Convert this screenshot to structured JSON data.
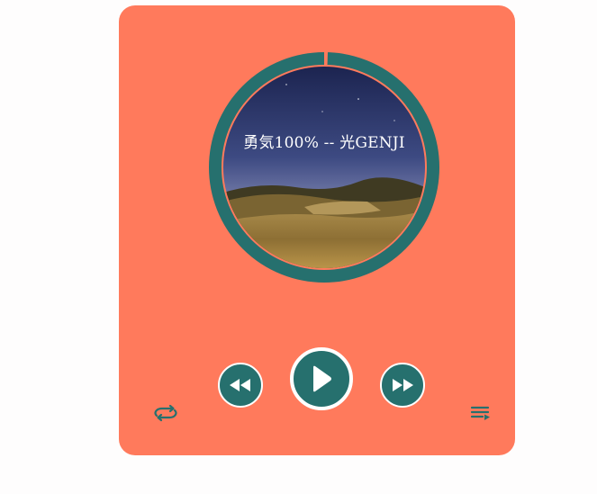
{
  "track": {
    "title": "勇気100% -- 光GENJI",
    "progress": 0.005
  },
  "controls": {
    "loop_icon": "loop-icon",
    "rewind_icon": "rewind-icon",
    "play_icon": "play-icon",
    "forward_icon": "fast-forward-icon",
    "playlist_icon": "playlist-icon"
  },
  "colors": {
    "card": "#ff7a5c",
    "accent": "#26706e",
    "progress": "#ff7a5c"
  }
}
